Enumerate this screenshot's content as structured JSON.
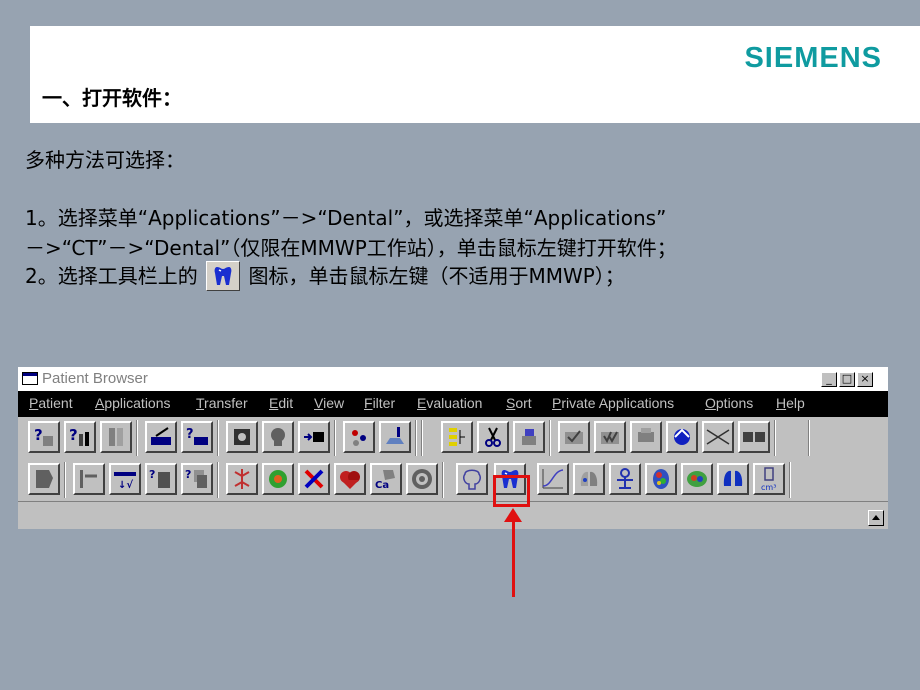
{
  "header": {
    "logo": "SIEMENS",
    "section_title": "一、打开软件："
  },
  "instructions": {
    "intro": "多种方法可选择：",
    "step1_line1": "1。选择菜单“Applications”－>“Dental”，或选择菜单“Applications”",
    "step1_line2": "－>“CT”－>“Dental”（仅限在MMWP工作站），单击鼠标左键打开软件；",
    "step2_before": "2。选择工具栏上的",
    "step2_after": "图标，单击鼠标左键（不适用于MMWP）；"
  },
  "window": {
    "title": "Patient Browser",
    "controls": [
      "_",
      "□",
      "×"
    ],
    "menu": [
      "Patient",
      "Applications",
      "Transfer",
      "Edit",
      "View",
      "Filter",
      "Evaluation",
      "Sort",
      "Private Applications",
      "Options",
      "Help"
    ]
  },
  "toolbar_row1": [
    "help-query-icon",
    "help-context-icon",
    "columns-icon",
    "edit-icon",
    "help-edit-icon",
    "archive-icon",
    "head-icon",
    "transfer-icon",
    "network-icon",
    "import-icon",
    "tree-icon",
    "scissors-icon",
    "eraser-icon",
    "check-icon",
    "check-multiple-icon",
    "print-icon",
    "rotate-icon",
    "cross-icon",
    "film-icon"
  ],
  "toolbar_row2": [
    "document-icon",
    "pointer-icon",
    "sort-icon",
    "query-image-icon",
    "query-series-icon",
    "vessel-icon",
    "brain-icon",
    "cross-red-icon",
    "heart-icon",
    "calcium-icon",
    "ring-icon",
    "brain-outline-icon",
    "dental-icon",
    "curve-icon",
    "lung-icon",
    "molecule-icon",
    "brain-color-icon",
    "brain-color2-icon",
    "lungs-blue-icon",
    "volume-cm3-icon"
  ],
  "colors": {
    "background": "#97a3b1",
    "logo": "#0f9ba0",
    "highlight": "#e01010",
    "menu_bar": "#000000"
  }
}
